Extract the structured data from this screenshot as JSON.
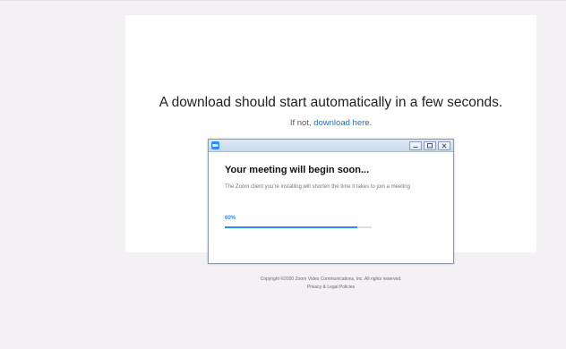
{
  "page": {
    "headline": "A download should start automatically in a few seconds.",
    "fallback_prefix": "If not, ",
    "fallback_link": "download here.",
    "copyright": "Copyright ©2020 Zoom Video Communications, Inc. All rights reserved.",
    "privacy_link": "Privacy & Legal Policies"
  },
  "installer": {
    "app_icon": "zoom-camera-icon",
    "title": "Your meeting will begin soon...",
    "body": "The Zoom client you're installing will shorten the time it takes to join a meeting",
    "progress_label": "60%",
    "progress_fraction": 0.9,
    "controls": [
      "minimize-icon",
      "maximize-icon",
      "close-icon"
    ]
  },
  "colors": {
    "accent": "#2d8cff",
    "link": "#1a6fd1",
    "page_background": "#f4f1f5"
  }
}
